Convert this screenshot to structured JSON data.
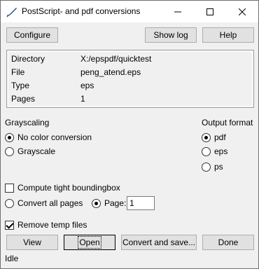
{
  "window": {
    "title": "PostScript- and pdf conversions"
  },
  "toolbar": {
    "configure_label": "Configure",
    "showlog_label": "Show log",
    "help_label": "Help"
  },
  "info": {
    "rows": [
      {
        "label": "Directory",
        "value": "X:/epspdf/quicktest"
      },
      {
        "label": "File",
        "value": "peng_atend.eps"
      },
      {
        "label": "Type",
        "value": "eps"
      },
      {
        "label": "Pages",
        "value": "1"
      }
    ]
  },
  "grayscaling": {
    "label": "Grayscaling",
    "options": [
      {
        "label": "No color conversion",
        "selected": true
      },
      {
        "label": "Grayscale",
        "selected": false
      }
    ]
  },
  "output_format": {
    "label": "Output format",
    "options": [
      {
        "label": "pdf",
        "selected": true
      },
      {
        "label": "eps",
        "selected": false
      },
      {
        "label": "ps",
        "selected": false
      }
    ]
  },
  "bbox": {
    "label": "Compute tight boundingbox",
    "checked": false
  },
  "pages": {
    "all_label": "Convert all pages",
    "all_selected": false,
    "page_label": "Page:",
    "page_selected": true,
    "page_value": "1"
  },
  "temp": {
    "label": "Remove temp files",
    "checked": true
  },
  "actions": {
    "view_label": "View",
    "open_label": "Open",
    "convert_label": "Convert and save...",
    "done_label": "Done"
  },
  "status": {
    "text": "Idle"
  }
}
